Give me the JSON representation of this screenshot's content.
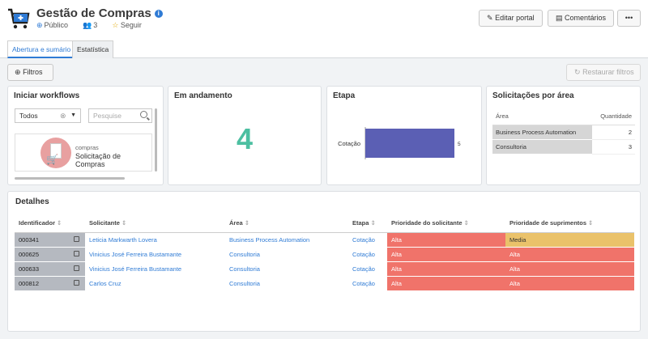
{
  "header": {
    "title": "Gestão de Compras",
    "visibility": "Público",
    "members": "3",
    "follow": "Seguir",
    "buttons": {
      "edit": "Editar portal",
      "comments": "Comentários",
      "more": "•••"
    }
  },
  "tabs": [
    {
      "label": "Abertura e sumário",
      "active": true
    },
    {
      "label": "Estatística",
      "active": false
    }
  ],
  "toolbar": {
    "filters": "Filtros",
    "reset": "Restaurar filtros"
  },
  "workflows": {
    "title": "Iniciar workflows",
    "select_value": "Todos",
    "search_placeholder": "Pesquise",
    "item": {
      "category": "compras",
      "name": "Solicitação de Compras"
    }
  },
  "in_progress": {
    "title": "Em andamento",
    "count": "4"
  },
  "stage": {
    "title": "Etapa"
  },
  "by_area": {
    "title": "Solicitações por área",
    "columns": [
      "Área",
      "Quantidade"
    ],
    "rows": [
      {
        "area": "Business Process Automation",
        "qty": "2"
      },
      {
        "area": "Consultoria",
        "qty": "3"
      }
    ]
  },
  "details": {
    "title": "Detalhes",
    "columns": [
      "Identificador",
      "Solicitante",
      "Área",
      "Etapa",
      "Prioridade do solicitante",
      "Prioridade de suprimentos"
    ],
    "rows": [
      {
        "id": "000341",
        "requester": "Leticia Markwarth Lovera",
        "area": "Business Process Automation",
        "stage": "Cotação",
        "prio_req": "Alta",
        "prio_sup": "Media"
      },
      {
        "id": "000625",
        "requester": "Vinicius José Ferreira Bustamante",
        "area": "Consultoria",
        "stage": "Cotação",
        "prio_req": "Alta",
        "prio_sup": "Alta"
      },
      {
        "id": "000633",
        "requester": "Vinicius José Ferreira Bustamante",
        "area": "Consultoria",
        "stage": "Cotação",
        "prio_req": "Alta",
        "prio_sup": "Alta"
      },
      {
        "id": "000812",
        "requester": "Carlos Cruz",
        "area": "Consultoria",
        "stage": "Cotação",
        "prio_req": "Alta",
        "prio_sup": "Alta"
      }
    ]
  },
  "chart_data": {
    "type": "bar",
    "orientation": "horizontal",
    "categories": [
      "Cotação"
    ],
    "values": [
      5
    ],
    "color": "#5b5fb4"
  },
  "colors": {
    "accent": "#2f7bd5",
    "count": "#4cbfa1",
    "alta": "#f0736a",
    "media": "#eac26a"
  }
}
